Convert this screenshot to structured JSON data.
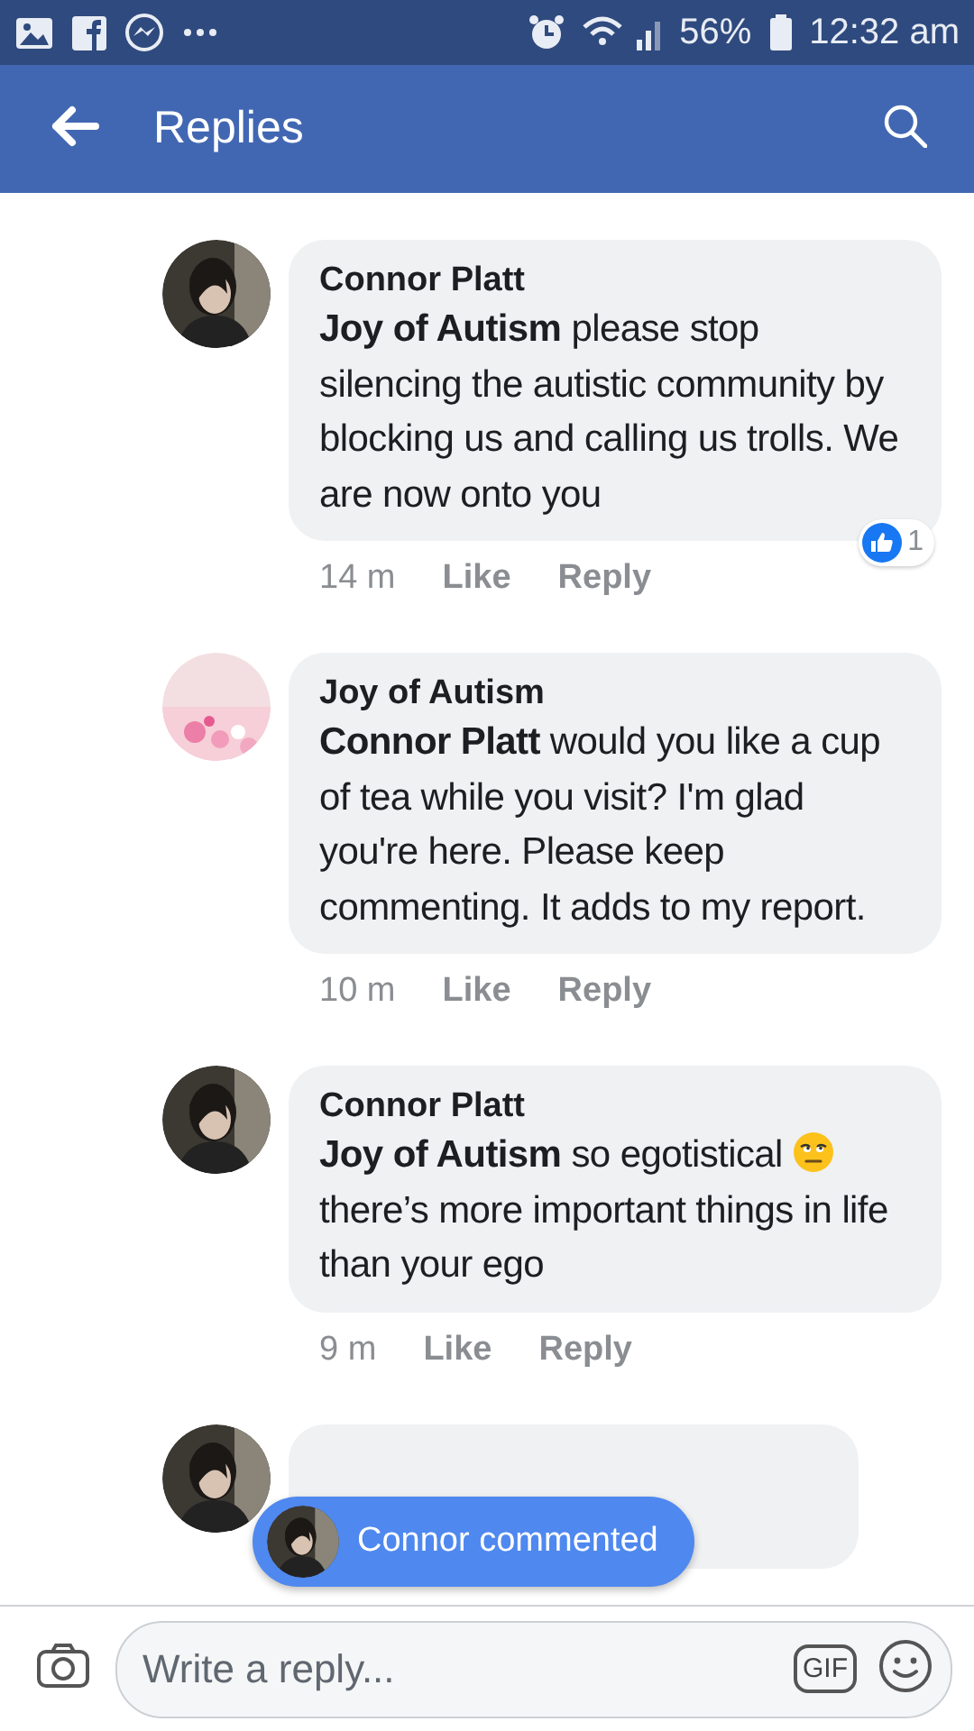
{
  "status_bar": {
    "battery": "56%",
    "time": "12:32 am"
  },
  "header": {
    "title": "Replies"
  },
  "comments": [
    {
      "author": "Connor Platt",
      "parts": [
        {
          "kind": "text",
          "text": "**Joy of Autism**  please stop silencing the autistic community by blocking us and calling us trolls. We are now onto you"
        }
      ],
      "time": "14 m",
      "like": "Like",
      "reply": "Reply",
      "reactions": "1"
    },
    {
      "author": "Joy of Autism",
      "parts": [
        {
          "kind": "text",
          "text": "**Connor Platt** would you like a cup of tea while you visit? I'm glad you're here. Please keep commenting. It adds to my report."
        }
      ],
      "time": "10 m",
      "like": "Like",
      "reply": "Reply"
    },
    {
      "author": "Connor Platt",
      "parts": [
        {
          "kind": "text",
          "text": "**Joy of Autism**  so egotistical"
        },
        {
          "kind": "emoji"
        },
        {
          "kind": "text",
          "text": "there’s more important things in life than your ego"
        }
      ],
      "time": "9 m",
      "like": "Like",
      "reply": "Reply"
    }
  ],
  "toast": {
    "text": "Connor commented"
  },
  "composer": {
    "placeholder": "Write a reply...",
    "gif": "GIF"
  }
}
